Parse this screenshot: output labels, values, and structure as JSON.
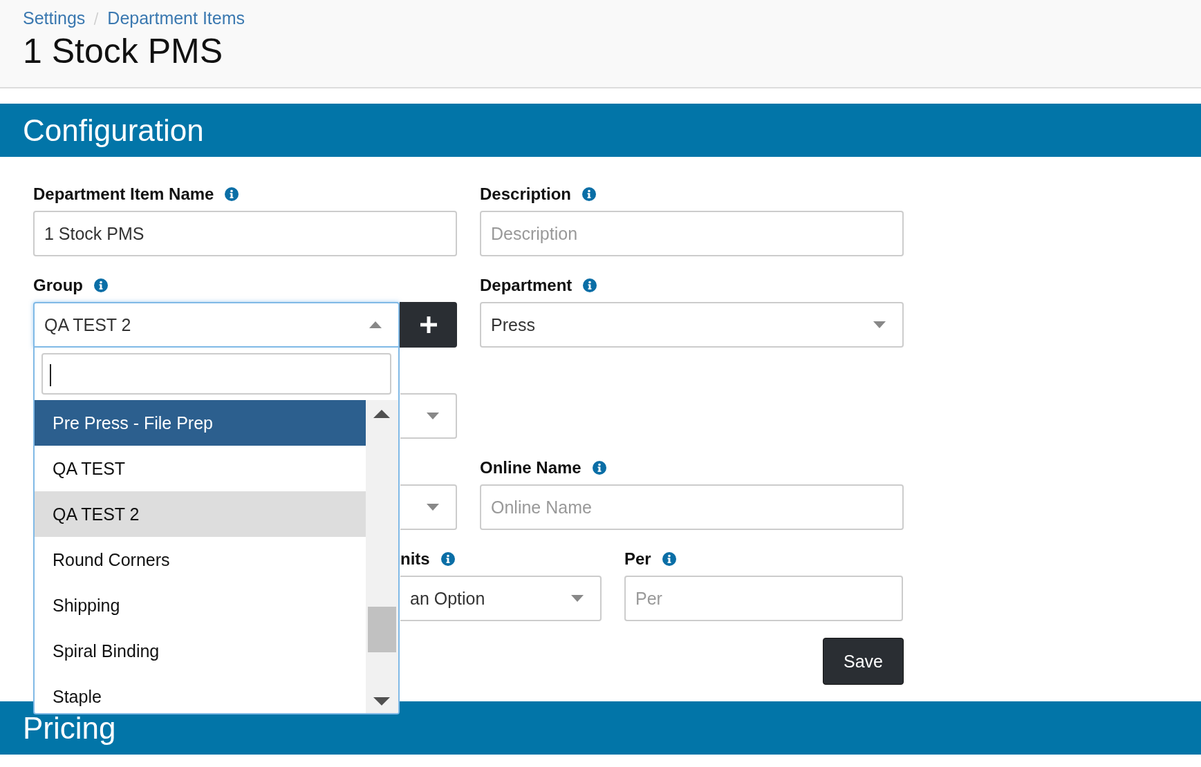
{
  "breadcrumbs": [
    "Settings",
    "Department Items"
  ],
  "page_title": "1 Stock PMS",
  "configuration_heading": "Configuration",
  "rows": [
    [
      {
        "kind": "text",
        "label": "Department Item Name",
        "value": "1 Stock PMS"
      },
      {
        "kind": "text",
        "label": "Description",
        "placeholder": "Description"
      }
    ],
    [
      {
        "kind": "group",
        "label": "Group",
        "value": "QA TEST 2",
        "expanded": true
      },
      {
        "kind": "select",
        "label": "Department",
        "value": "Press"
      }
    ],
    [
      {
        "kind": "select",
        "covered": true
      }
    ],
    [
      {
        "kind": "select",
        "covered": true
      },
      {
        "kind": "text",
        "label": "Online Name",
        "placeholder": "Online Name"
      }
    ],
    [
      {
        "kind": "select",
        "covered": true,
        "label": "nits",
        "value": "an Option"
      },
      {
        "kind": "text",
        "label": "Per",
        "placeholder": "Per"
      }
    ]
  ],
  "group_options": [
    {
      "label": "Pre Press - File Prep",
      "highlighted": true,
      "selected": false
    },
    {
      "label": "QA TEST",
      "highlighted": false,
      "selected": false
    },
    {
      "label": "QA TEST 2",
      "highlighted": false,
      "selected": true
    },
    {
      "label": "Round Corners",
      "highlighted": false,
      "selected": false
    },
    {
      "label": "Shipping",
      "highlighted": false,
      "selected": false
    },
    {
      "label": "Spiral Binding",
      "highlighted": false,
      "selected": false
    },
    {
      "label": "Staple",
      "highlighted": false,
      "selected": false
    }
  ],
  "save_button": "Save",
  "pricing_heading": "Pricing"
}
